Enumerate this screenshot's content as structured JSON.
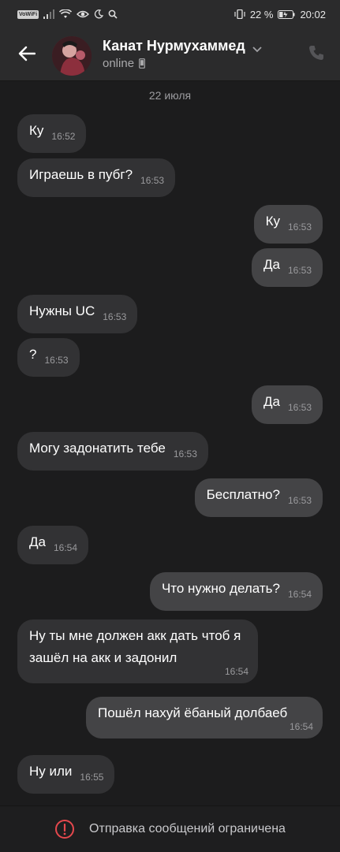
{
  "status_bar": {
    "volte": "VoWiFi",
    "battery": "22 %",
    "time": "20:02"
  },
  "header": {
    "contact_name": "Канат Нурмухаммед",
    "presence": "online"
  },
  "date_separator": "22 июля",
  "messages": [
    {
      "dir": "in",
      "text": "Ку",
      "time": "16:52"
    },
    {
      "dir": "in",
      "text": "Играешь в пубг?",
      "time": "16:53"
    },
    {
      "dir": "out",
      "text": "Ку",
      "time": "16:53"
    },
    {
      "dir": "out",
      "text": "Да",
      "time": "16:53"
    },
    {
      "dir": "in",
      "text": "Нужны UC",
      "time": "16:53"
    },
    {
      "dir": "in",
      "text": "?",
      "time": "16:53"
    },
    {
      "dir": "out",
      "text": "Да",
      "time": "16:53"
    },
    {
      "dir": "in",
      "text": "Могу задонатить тебе",
      "time": "16:53"
    },
    {
      "dir": "out",
      "text": "Бесплатно?",
      "time": "16:53"
    },
    {
      "dir": "in",
      "text": "Да",
      "time": "16:54"
    },
    {
      "dir": "out",
      "text": "Что нужно делать?",
      "time": "16:54"
    },
    {
      "dir": "in",
      "text": "Ну ты мне должен акк дать чтоб я зашёл на акк и задонил",
      "time": "16:54"
    },
    {
      "dir": "out",
      "text": "Пошёл нахуй ёбаный долбаеб",
      "time": "16:54"
    },
    {
      "dir": "in",
      "text": "Ну или",
      "time": "16:55"
    }
  ],
  "footer": {
    "notice": "Отправка сообщений ограничена",
    "icon": "alert-icon",
    "icon_color": "#e5484d"
  },
  "colors": {
    "background": "#1c1c1d",
    "incoming_bubble": "#323234",
    "outgoing_bubble": "#444446",
    "header": "#2b2b2c"
  }
}
